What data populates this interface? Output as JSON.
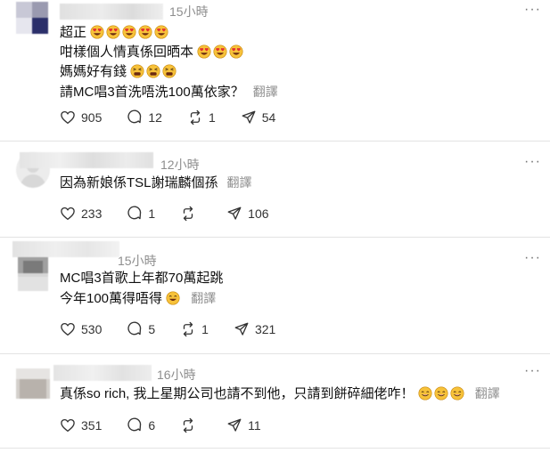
{
  "posts": [
    {
      "time": "15小時",
      "lines": [
        "超正",
        "咁樣個人情真係回晒本",
        "媽媽好有錢",
        "請MC唱3首洗唔洗100萬依家？"
      ],
      "translate": "翻譯",
      "likes": "905",
      "replies": "12",
      "reposts": "1",
      "shares": "54"
    },
    {
      "time": "12小時",
      "lines": [
        "因為新娘係TSL謝瑞麟個孫"
      ],
      "translate": "翻譯",
      "likes": "233",
      "replies": "1",
      "reposts": "",
      "shares": "106"
    },
    {
      "time": "15小時",
      "lines": [
        "MC唱3首歌上年都70萬起跳",
        "今年100萬得唔得"
      ],
      "translate": "翻譯",
      "likes": "530",
      "replies": "5",
      "reposts": "1",
      "shares": "321"
    },
    {
      "time": "16小時",
      "lines": [
        "真係so rich, 我上星期公司也請不到他，只請到餅碎細佬咋！"
      ],
      "translate": "翻譯",
      "likes": "351",
      "replies": "6",
      "reposts": "",
      "shares": "11"
    }
  ],
  "icons": {
    "heart": "heart-icon",
    "reply": "speech-bubble-icon",
    "repost": "repost-icon",
    "share": "send-icon",
    "more": "more-icon",
    "heart_eyes": "heart-eyes-emoji",
    "tired": "tired-face-emoji",
    "grin": "grinning-face-emoji"
  },
  "colors": {
    "muted": "#8e8e8e",
    "divider": "#e3e3e3",
    "emoji": "#f7c23a"
  }
}
